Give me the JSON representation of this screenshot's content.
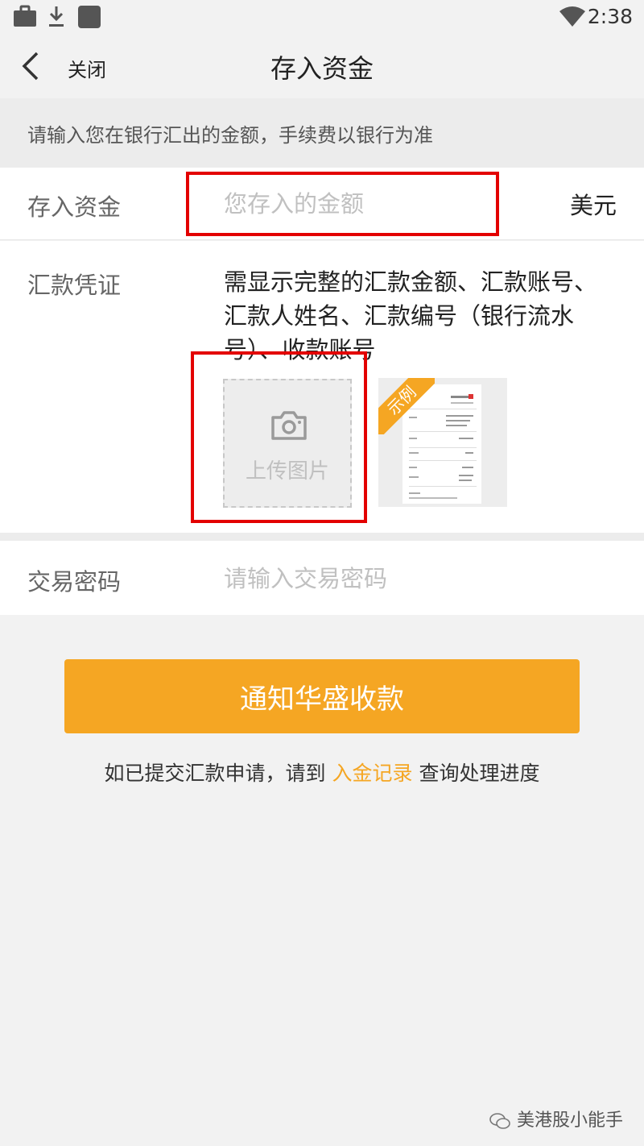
{
  "status_bar": {
    "time": "2:38"
  },
  "nav": {
    "close_label": "关闭",
    "title": "存入资金"
  },
  "hint": "请输入您在银行汇出的金额，手续费以银行为准",
  "amount": {
    "label": "存入资金",
    "placeholder": "您存入的金额",
    "value": "",
    "currency": "美元"
  },
  "voucher": {
    "label": "汇款凭证",
    "description": "需显示完整的汇款金额、汇款账号、汇款人姓名、汇款编号（银行流水号）、收款账号",
    "upload_label": "上传图片",
    "example_ribbon": "示例"
  },
  "password": {
    "label": "交易密码",
    "placeholder": "请输入交易密码"
  },
  "submit_label": "通知华盛收款",
  "footnote": {
    "before": "如已提交汇款申请，请到 ",
    "link": "入金记录",
    "after": " 查询处理进度"
  },
  "watermark": "美港股小能手",
  "colors": {
    "accent": "#f5a623",
    "highlight_box": "#e30000",
    "background": "#f2f2f2"
  },
  "icons": [
    "briefcase-icon",
    "download-icon",
    "app-square-icon",
    "wifi-icon",
    "back-chevron-icon",
    "camera-icon",
    "wechat-icon"
  ]
}
